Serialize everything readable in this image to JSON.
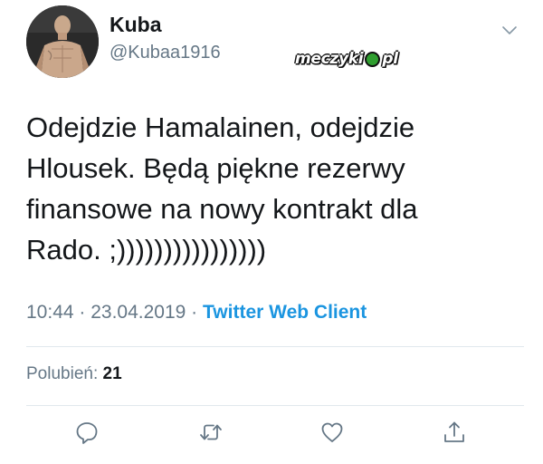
{
  "tweet": {
    "author": {
      "name": "Kuba",
      "handle": "@Kubaa1916"
    },
    "text": "Odejdzie Hamalainen, odejdzie Hlousek. Będą piękne rezerwy finansowe na nowy kontrakt dla Rado. ;))))))))))))))))",
    "time": "10:44",
    "sep1": " · ",
    "date": "23.04.2019",
    "sep2": " · ",
    "client": "Twitter Web Client",
    "likes_label": "Polubień:",
    "likes_count": "21"
  },
  "watermark": {
    "left": "meczyki",
    "right": "pl"
  },
  "icons": {
    "menu": "chevron-down-icon",
    "reply": "reply-icon",
    "retweet": "retweet-icon",
    "like": "like-icon",
    "share": "share-icon"
  },
  "colors": {
    "primary_text": "#14171a",
    "secondary_text": "#657786",
    "link": "#1b95e0",
    "divider": "#e1e8ed"
  }
}
